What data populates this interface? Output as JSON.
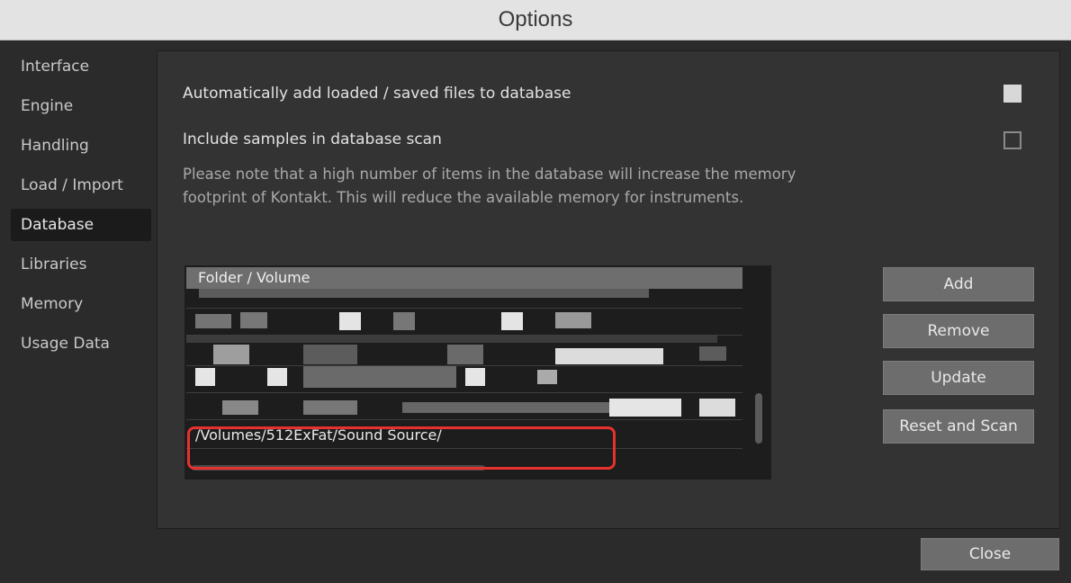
{
  "window": {
    "title": "Options"
  },
  "sidebar": {
    "items": [
      {
        "label": "Interface"
      },
      {
        "label": "Engine"
      },
      {
        "label": "Handling"
      },
      {
        "label": "Load / Import"
      },
      {
        "label": "Database",
        "active": true
      },
      {
        "label": "Libraries"
      },
      {
        "label": "Memory"
      },
      {
        "label": "Usage Data"
      }
    ]
  },
  "options": {
    "auto_add": {
      "label": "Automatically add loaded / saved files to database",
      "checked": true
    },
    "include_samples": {
      "label": "Include samples in database scan",
      "checked": false
    },
    "note": "Please note that a high number of items in the database will increase the memory footprint of Kontakt. This will reduce the available memory for instruments."
  },
  "table": {
    "header": "Folder / Volume",
    "highlighted_row": "/Volumes/512ExFat/Sound Source/"
  },
  "buttons": {
    "add": "Add",
    "remove": "Remove",
    "update": "Update",
    "reset_scan": "Reset and Scan",
    "close": "Close"
  },
  "colors": {
    "highlight": "#e5322d",
    "panel": "#333333",
    "button": "#6d6d6d"
  }
}
